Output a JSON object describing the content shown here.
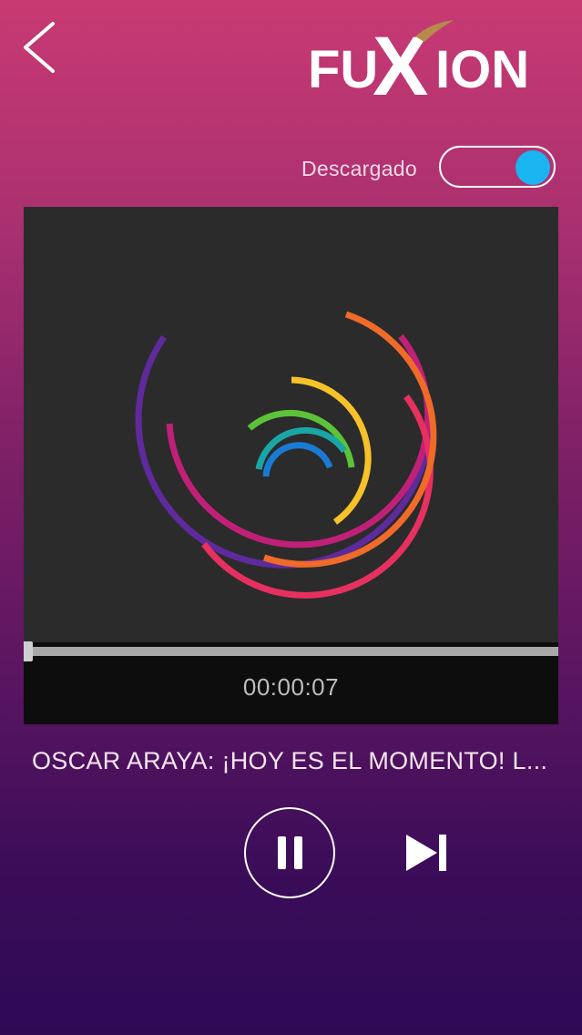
{
  "header": {
    "back_icon": "chevron-left-icon",
    "logo_text": "FUXION"
  },
  "download": {
    "label": "Descargado",
    "enabled": true,
    "accent_color": "#1ab4f0"
  },
  "player": {
    "elapsed_time": "00:00:07",
    "progress": 0.0,
    "track_title": "OSCAR ARAYA: ¡HOY ES EL MOMENTO! L...",
    "pause_icon": "pause-icon",
    "next_icon": "skip-next-icon"
  },
  "colors": {
    "background_top": "#c83a72",
    "background_bottom": "#2e0a55",
    "panel": "#2b2b2b"
  }
}
